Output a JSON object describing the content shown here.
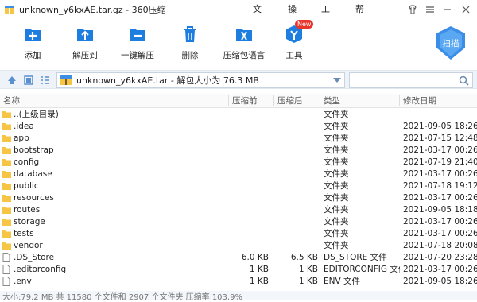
{
  "window": {
    "title": "unknown_y6kxAE.tar.gz - 360压缩",
    "menu": [
      "文件",
      "操作",
      "工具",
      "帮助"
    ]
  },
  "toolbar": {
    "buttons": [
      {
        "label": "添加",
        "icon": "add-icon"
      },
      {
        "label": "解压到",
        "icon": "extract-to-icon"
      },
      {
        "label": "一键解压",
        "icon": "one-click-extract-icon"
      },
      {
        "label": "删除",
        "icon": "delete-icon"
      },
      {
        "label": "压缩包语言",
        "icon": "language-icon"
      },
      {
        "label": "工具",
        "icon": "tools-icon",
        "badge": "New"
      }
    ],
    "scan_label": "扫描"
  },
  "address": {
    "path": "unknown_y6kxAE.tar - 解包大小为 76.3 MB",
    "search_value": ""
  },
  "columns": {
    "name": "名称",
    "packed": "压缩前",
    "compressed": "压缩后",
    "type": "类型",
    "modified": "修改日期"
  },
  "files": [
    {
      "name": "..(上级目录)",
      "packed": "",
      "compressed": "",
      "type": "文件夹",
      "date": "",
      "kind": "folder"
    },
    {
      "name": ".idea",
      "packed": "",
      "compressed": "",
      "type": "文件夹",
      "date": "2021-09-05 18:26",
      "kind": "folder"
    },
    {
      "name": "app",
      "packed": "",
      "compressed": "",
      "type": "文件夹",
      "date": "2021-07-15 12:48",
      "kind": "folder"
    },
    {
      "name": "bootstrap",
      "packed": "",
      "compressed": "",
      "type": "文件夹",
      "date": "2021-03-17 00:26",
      "kind": "folder"
    },
    {
      "name": "config",
      "packed": "",
      "compressed": "",
      "type": "文件夹",
      "date": "2021-07-19 21:40",
      "kind": "folder"
    },
    {
      "name": "database",
      "packed": "",
      "compressed": "",
      "type": "文件夹",
      "date": "2021-03-17 00:26",
      "kind": "folder"
    },
    {
      "name": "public",
      "packed": "",
      "compressed": "",
      "type": "文件夹",
      "date": "2021-07-18 19:12",
      "kind": "folder"
    },
    {
      "name": "resources",
      "packed": "",
      "compressed": "",
      "type": "文件夹",
      "date": "2021-03-17 00:26",
      "kind": "folder"
    },
    {
      "name": "routes",
      "packed": "",
      "compressed": "",
      "type": "文件夹",
      "date": "2021-09-05 18:18",
      "kind": "folder"
    },
    {
      "name": "storage",
      "packed": "",
      "compressed": "",
      "type": "文件夹",
      "date": "2021-03-17 00:26",
      "kind": "folder"
    },
    {
      "name": "tests",
      "packed": "",
      "compressed": "",
      "type": "文件夹",
      "date": "2021-03-17 00:26",
      "kind": "folder"
    },
    {
      "name": "vendor",
      "packed": "",
      "compressed": "",
      "type": "文件夹",
      "date": "2021-07-18 20:08",
      "kind": "folder"
    },
    {
      "name": ".DS_Store",
      "packed": "6.0 KB",
      "compressed": "6.5 KB",
      "type": "DS_STORE 文件",
      "date": "2021-07-20 23:28",
      "kind": "file"
    },
    {
      "name": ".editorconfig",
      "packed": "1 KB",
      "compressed": "1 KB",
      "type": "EDITORCONFIG 文件",
      "date": "2021-03-17 00:26",
      "kind": "file"
    },
    {
      "name": ".env",
      "packed": "1 KB",
      "compressed": "1 KB",
      "type": "ENV 文件",
      "date": "2021-09-05 18:26",
      "kind": "file"
    }
  ],
  "status": {
    "text": "大小:79.2 MB 共 11580 个文件和 2907 个文件夹 压缩率 103.9%"
  },
  "colors": {
    "accent": "#1d7ee0",
    "folder": "#f6c544",
    "address_bg": "#eef3f9"
  }
}
